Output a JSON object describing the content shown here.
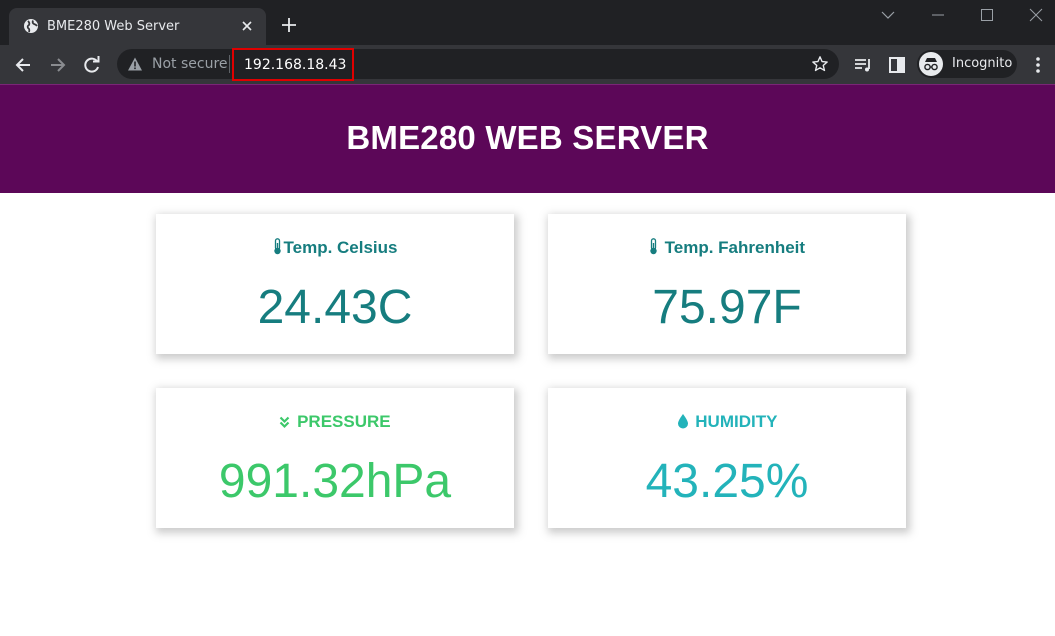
{
  "browser": {
    "tab_title": "BME280 Web Server",
    "security_label": "Not secure",
    "url": "192.168.18.43",
    "profile_label": "Incognito"
  },
  "page": {
    "heading": "BME280 WEB SERVER",
    "cards": [
      {
        "title": "Temp. Celsius",
        "icon": "thermometer-icon",
        "value": "24.43C",
        "color": "#167d7f"
      },
      {
        "title": "Temp. Fahrenheit",
        "icon": "thermometer-icon",
        "value": "75.97F",
        "color": "#167d7f"
      },
      {
        "title": "PRESSURE",
        "icon": "angles-down-icon",
        "value": "991.32hPa",
        "color": "#3cc86a"
      },
      {
        "title": "HUMIDITY",
        "icon": "droplet-icon",
        "value": "43.25%",
        "color": "#23b3ba"
      }
    ],
    "colors": {
      "header_bg": "#5c0758",
      "url_highlight": "#e00000"
    }
  }
}
